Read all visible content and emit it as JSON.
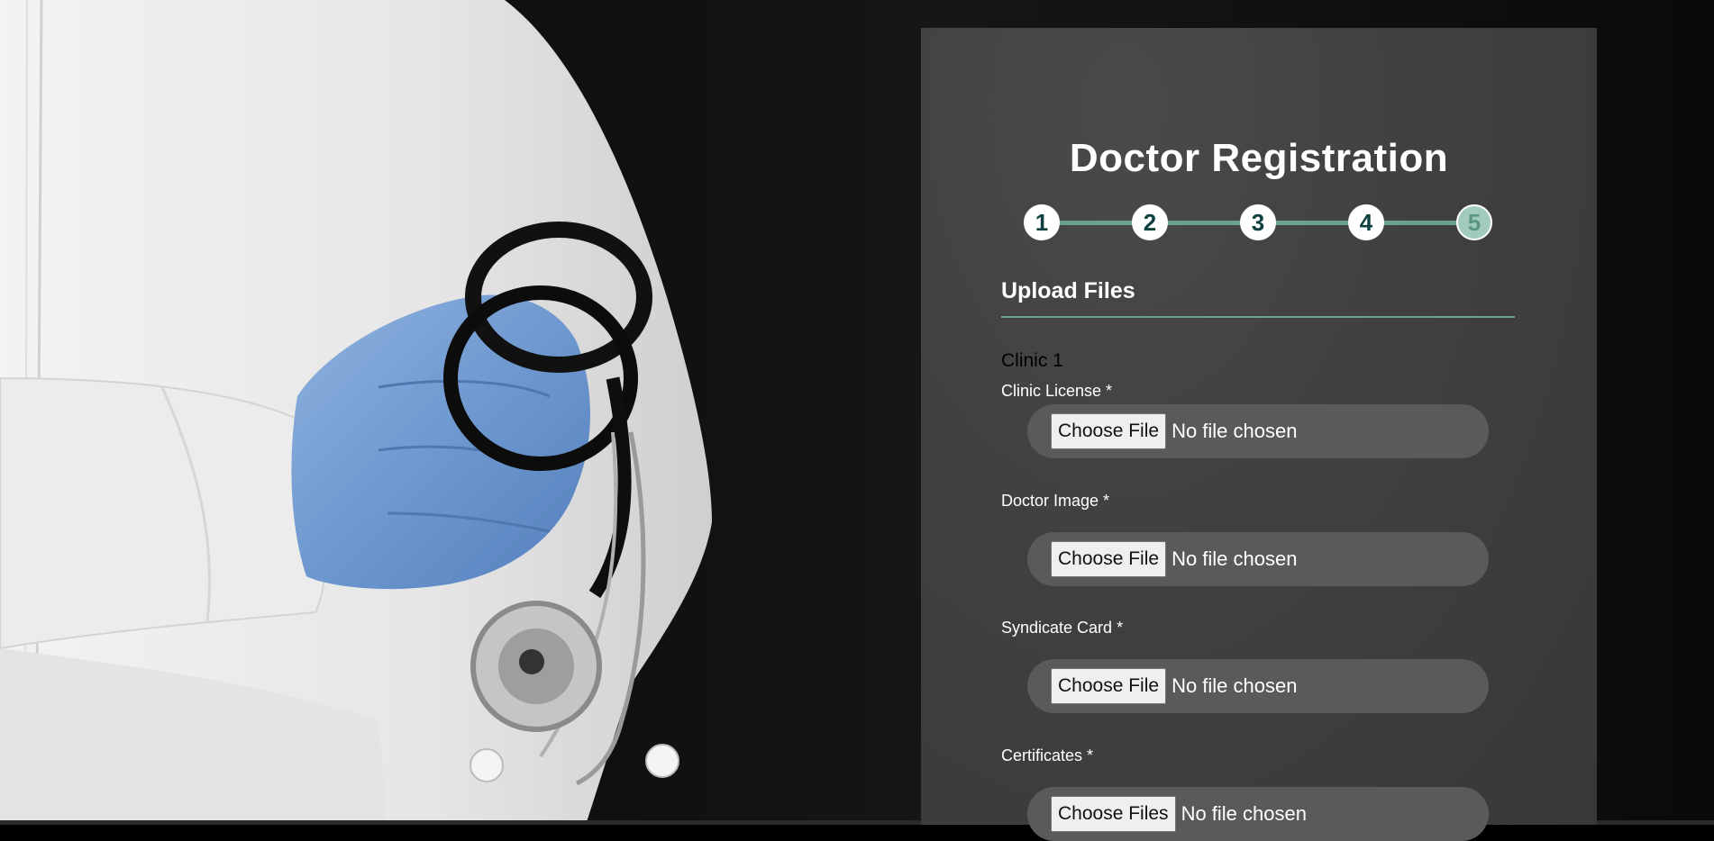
{
  "background": {
    "image": "doctor-in-white-coat-with-blue-glove-holding-stethoscope"
  },
  "colors": {
    "panel": "#414141",
    "accent": "#6aa28e",
    "step_text": "#0f4040",
    "pill": "#5a5a5a"
  },
  "form": {
    "title": "Doctor Registration",
    "steps": [
      "1",
      "2",
      "3",
      "4",
      "5"
    ],
    "active_step": "5",
    "section_title": "Upload Files",
    "clinic_heading": "Clinic 1",
    "fields": [
      {
        "label": "Clinic License *",
        "button": "Choose File",
        "status": "No file chosen"
      },
      {
        "label": "Doctor Image *",
        "button": "Choose File",
        "status": "No file chosen"
      },
      {
        "label": "Syndicate Card *",
        "button": "Choose File",
        "status": "No file chosen"
      },
      {
        "label": "Certificates *",
        "button": "Choose Files",
        "status": "No file chosen"
      }
    ]
  }
}
